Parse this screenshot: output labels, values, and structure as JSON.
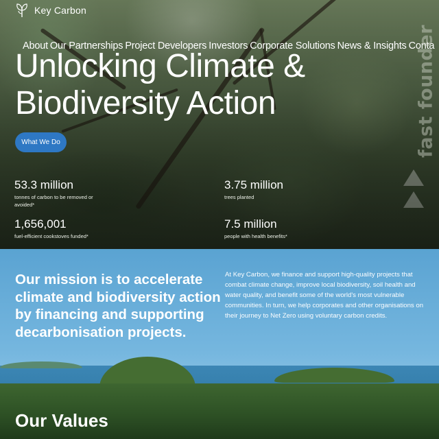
{
  "brand": {
    "name": "Key Carbon",
    "logo_icon": "leaf-tree-logo-icon"
  },
  "nav": {
    "items": [
      "About",
      "Our Partnerships",
      "Project Developers",
      "Investors",
      "Corporate Solutions",
      "News & Insights",
      "Conta"
    ]
  },
  "hero": {
    "title_line1": "Unlocking Climate &",
    "title_line2": "Biodiversity Action",
    "cta_label": "What We Do",
    "stats": [
      {
        "value": "53.3 million",
        "label_line1": "tonnes of carbon to be removed or",
        "label_line2": "avoided*"
      },
      {
        "value": "3.75 million",
        "label_line1": "trees planted",
        "label_line2": ""
      },
      {
        "value": "1,656,001",
        "label_line1": "fuel-efficient cookstoves funded*",
        "label_line2": ""
      },
      {
        "value": "7.5 million",
        "label_line1": "people with health benefits*",
        "label_line2": ""
      }
    ]
  },
  "badge": {
    "text": "fast founder",
    "icon": "triangles-icon"
  },
  "mission": {
    "title": "Our mission is to accelerate climate and biodiversity action by financing and supporting decarbonisation projects.",
    "body": "At Key Carbon, we finance and support high-quality projects that combat climate change, improve local biodiversity, soil health and water quality, and benefit some of the world's most vulnerable communities. In turn, we help corporates and other organisations on their journey to Net Zero using voluntary carbon credits."
  },
  "values": {
    "title": "Our Values"
  },
  "colors": {
    "cta": "#2e78c4",
    "sky": "#76b7df",
    "text": "#ffffff"
  }
}
